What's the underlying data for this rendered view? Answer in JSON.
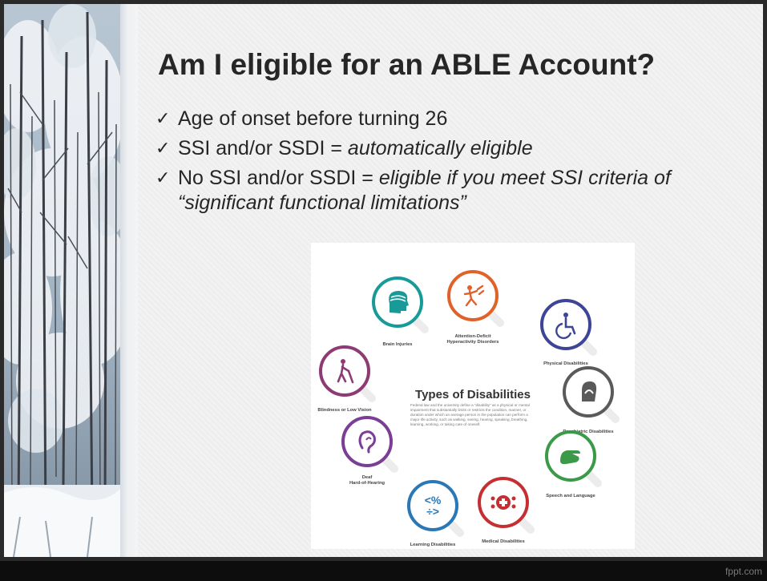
{
  "slide": {
    "title": "Am I eligible for an ABLE Account?",
    "bullets": [
      {
        "text": "Age of onset before turning 26",
        "emphasis": ""
      },
      {
        "text": "SSI and/or SSDI = ",
        "emphasis": "automatically eligible"
      },
      {
        "text": "No SSI and/or SSDI = ",
        "emphasis": "eligible if you meet SSI criteria of “significant functional limitations”"
      }
    ],
    "check_glyph": "✓"
  },
  "infographic": {
    "title": "Types of Disabilities",
    "description": "Federal law and the university define a “disability” as a physical or mental impairment that substantially limits or restricts the condition, manner, or duration under which an average person in the population can perform a major life activity, such as walking, seeing, hearing, speaking, breathing, learning, working, or taking care of oneself.",
    "categories": [
      {
        "label_lines": [
          "Attention-Deficit",
          "Hyperactivity Disorders"
        ],
        "icon": "running-person-icon",
        "color": "#e0612a"
      },
      {
        "label_lines": [
          "Physical Disabilities"
        ],
        "icon": "wheelchair-icon",
        "color": "#3f4596"
      },
      {
        "label_lines": [
          "Psychiatric Disabilities"
        ],
        "icon": "head-in-hands-icon",
        "color": "#5a5a5a"
      },
      {
        "label_lines": [
          "Speech and Language"
        ],
        "icon": "sign-language-icon",
        "color": "#3a9a48"
      },
      {
        "label_lines": [
          "Medical Disabilities"
        ],
        "icon": "medical-cross-icon",
        "color": "#c62f32"
      },
      {
        "label_lines": [
          "Learning Disabilities"
        ],
        "icon": "math-symbols-icon",
        "color": "#2b78b6"
      },
      {
        "label_lines": [
          "Deaf",
          "Hard-of-Hearing"
        ],
        "icon": "ear-icon",
        "color": "#7a3f95"
      },
      {
        "label_lines": [
          "Blindness or Low Vision"
        ],
        "icon": "person-with-cane-icon",
        "color": "#8e3a74"
      },
      {
        "label_lines": [
          "Brain Injuries"
        ],
        "icon": "brain-head-icon",
        "color": "#189a99"
      }
    ],
    "math_symbols": [
      "<%",
      "÷>"
    ]
  },
  "footer": {
    "brand": "fppt.com"
  }
}
